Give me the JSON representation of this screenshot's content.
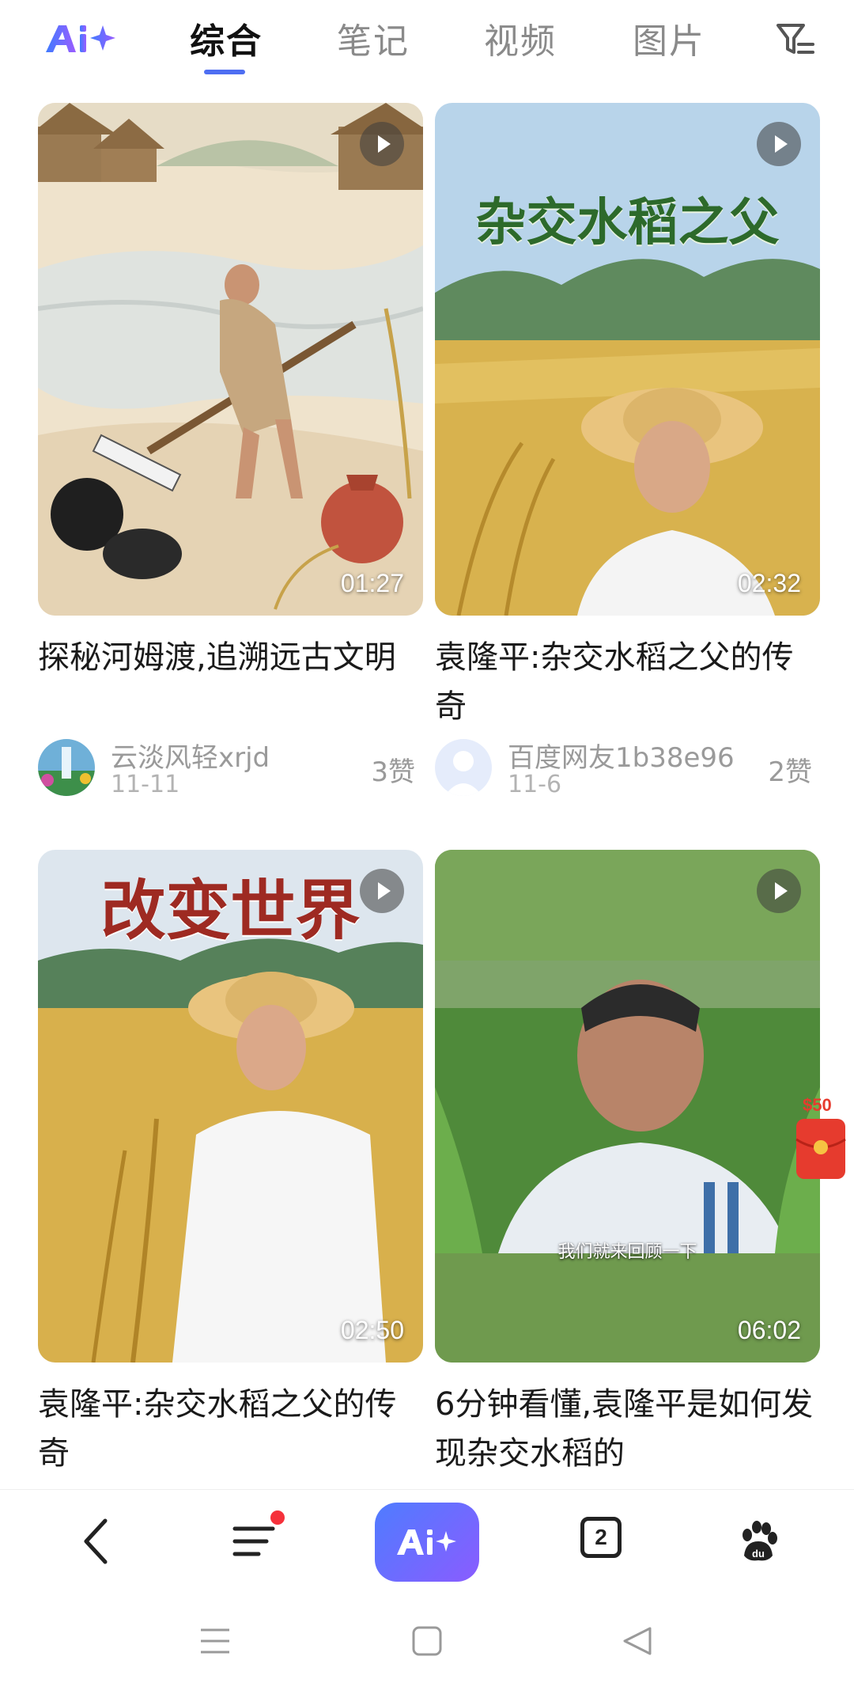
{
  "header": {
    "tabs": [
      {
        "label": "综合",
        "active": true
      },
      {
        "label": "笔记",
        "active": false
      },
      {
        "label": "视频",
        "active": false
      },
      {
        "label": "图片",
        "active": false
      }
    ],
    "logo_icon": "ai-sparkle-logo",
    "filter_icon": "filter-icon",
    "accent_color": "#4e6ef2"
  },
  "cards": [
    {
      "title": "探秘河姆渡,追溯远古文明",
      "duration": "01:27",
      "overlay_title": "",
      "author": "云淡风轻xrjd",
      "date": "11-11",
      "likes": "3赞"
    },
    {
      "title": "袁隆平:杂交水稻之父的传奇",
      "duration": "02:32",
      "overlay_title": "杂交水稻之父",
      "author": "百度网友1b38e96",
      "date": "11-6",
      "likes": "2赞"
    },
    {
      "title": "袁隆平:杂交水稻之父的传奇",
      "duration": "02:50",
      "overlay_title": "改变世界"
    },
    {
      "title": "6分钟看懂,袁隆平是如何发现杂交水稻的",
      "duration": "06:02",
      "subtitle": "我们就来回顾一下"
    }
  ],
  "red_packet": {
    "amount": "$50",
    "color": "#e63b2e"
  },
  "bottom_nav": {
    "items": [
      "back-icon",
      "menu-icon",
      "ai-assistant-icon",
      "tabs-icon",
      "baidu-paw-icon"
    ],
    "tab_count": "2"
  },
  "system_nav": [
    "recent-apps-icon",
    "home-icon",
    "back-triangle-icon"
  ]
}
